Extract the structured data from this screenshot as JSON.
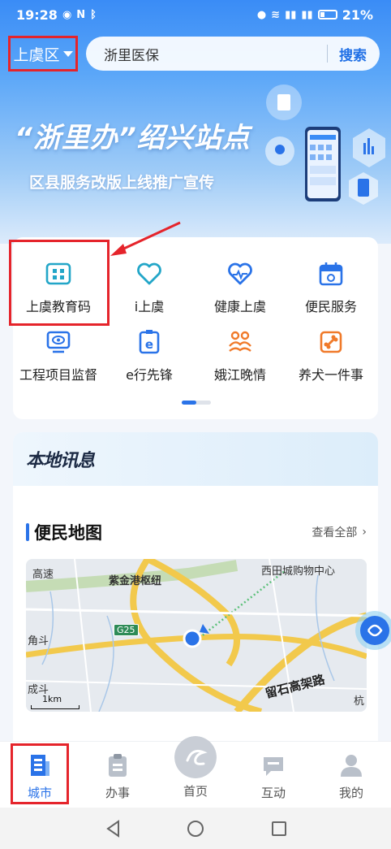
{
  "status_bar": {
    "time": "19:28",
    "battery": "21%"
  },
  "header": {
    "district": "上虞区",
    "search_placeholder": "浙里医保",
    "search_button": "搜索"
  },
  "banner": {
    "title": "“浙里办”绍兴站点",
    "subtitle": "区县服务改版上线推广宣传"
  },
  "services": [
    {
      "label": "上虞教育码",
      "icon": "education-code-icon",
      "color": "#23a6c8"
    },
    {
      "label": "i上虞",
      "icon": "heart-icon",
      "color": "#23a6c8"
    },
    {
      "label": "健康上虞",
      "icon": "health-heart-icon",
      "color": "#2a73e8"
    },
    {
      "label": "便民服务",
      "icon": "calendar-icon",
      "color": "#2a73e8"
    },
    {
      "label": "工程项目监督",
      "icon": "monitor-eye-icon",
      "color": "#2a73e8"
    },
    {
      "label": "e行先锋",
      "icon": "e-badge-icon",
      "color": "#2a73e8"
    },
    {
      "label": "娥江晚情",
      "icon": "people-icon",
      "color": "#f07a2a"
    },
    {
      "label": "养犬一件事",
      "icon": "dog-bone-icon",
      "color": "#f07a2a"
    }
  ],
  "news": {
    "title": "本地讯息"
  },
  "map_section": {
    "title": "便民地图",
    "see_all": "查看全部",
    "labels": {
      "highway": "高速",
      "hub": "紫金港枢纽",
      "mall": "西田城购物中心",
      "g25": "G25",
      "jiaodou": "角斗",
      "chengdou": "成斗",
      "elevated": "留石高架路",
      "hang": "杭",
      "scale": "1km"
    }
  },
  "tabbar": [
    {
      "label": "城市",
      "icon": "city-icon",
      "active": true
    },
    {
      "label": "办事",
      "icon": "clipboard-icon",
      "active": false
    },
    {
      "label": "首页",
      "icon": "home-logo-icon",
      "active": false
    },
    {
      "label": "互动",
      "icon": "chat-icon",
      "active": false
    },
    {
      "label": "我的",
      "icon": "user-icon",
      "active": false
    }
  ],
  "colors": {
    "primary": "#2a73e8",
    "annotation_red": "#e5242b"
  }
}
